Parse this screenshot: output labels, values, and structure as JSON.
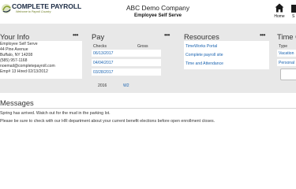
{
  "header": {
    "brand": "COMPLETE PAYROLL",
    "tagline": "Welcome to Payroll Country",
    "company": "ABC Demo Company",
    "portal": "Employee Self Serve",
    "home_label": "Home",
    "next_label": "S"
  },
  "your_info": {
    "title": "Your Info",
    "menu": "•••",
    "lines": [
      "Employee Self Serve",
      "44 Pine Avenue",
      "Buffalo, NY 14208",
      "(585) 957-1168",
      "noemail@completepayroll.com",
      "Emp# 13 Hired 02/13/2012"
    ]
  },
  "pay": {
    "title": "Pay",
    "menu": "•••",
    "col_checks": "Checks",
    "col_gross": "Gross",
    "checks": [
      "06/13/2017",
      "04/04/2017",
      "03/28/2017"
    ],
    "year": "2016",
    "w2": "W2"
  },
  "resources": {
    "title": "Resources",
    "menu": "•••",
    "links": [
      "TimeWorks Portal",
      "Complete payroll site",
      "Time and Attendance"
    ]
  },
  "time_off": {
    "title": "Time O",
    "col_type": "Type",
    "rows": [
      "Vacation",
      "Personal"
    ]
  },
  "messages": {
    "title": "Messages",
    "items": [
      "Spring has arrived. Watch out for the mud in the parking lot.",
      "Please be sure to check with our HR department about your current benefit elections before open enrollment closes."
    ]
  },
  "colors": {
    "panel_bg": "#e8e8e8",
    "link": "#1a63b0",
    "brand_navy": "#1c2b44",
    "brand_green": "#8aa12e"
  }
}
